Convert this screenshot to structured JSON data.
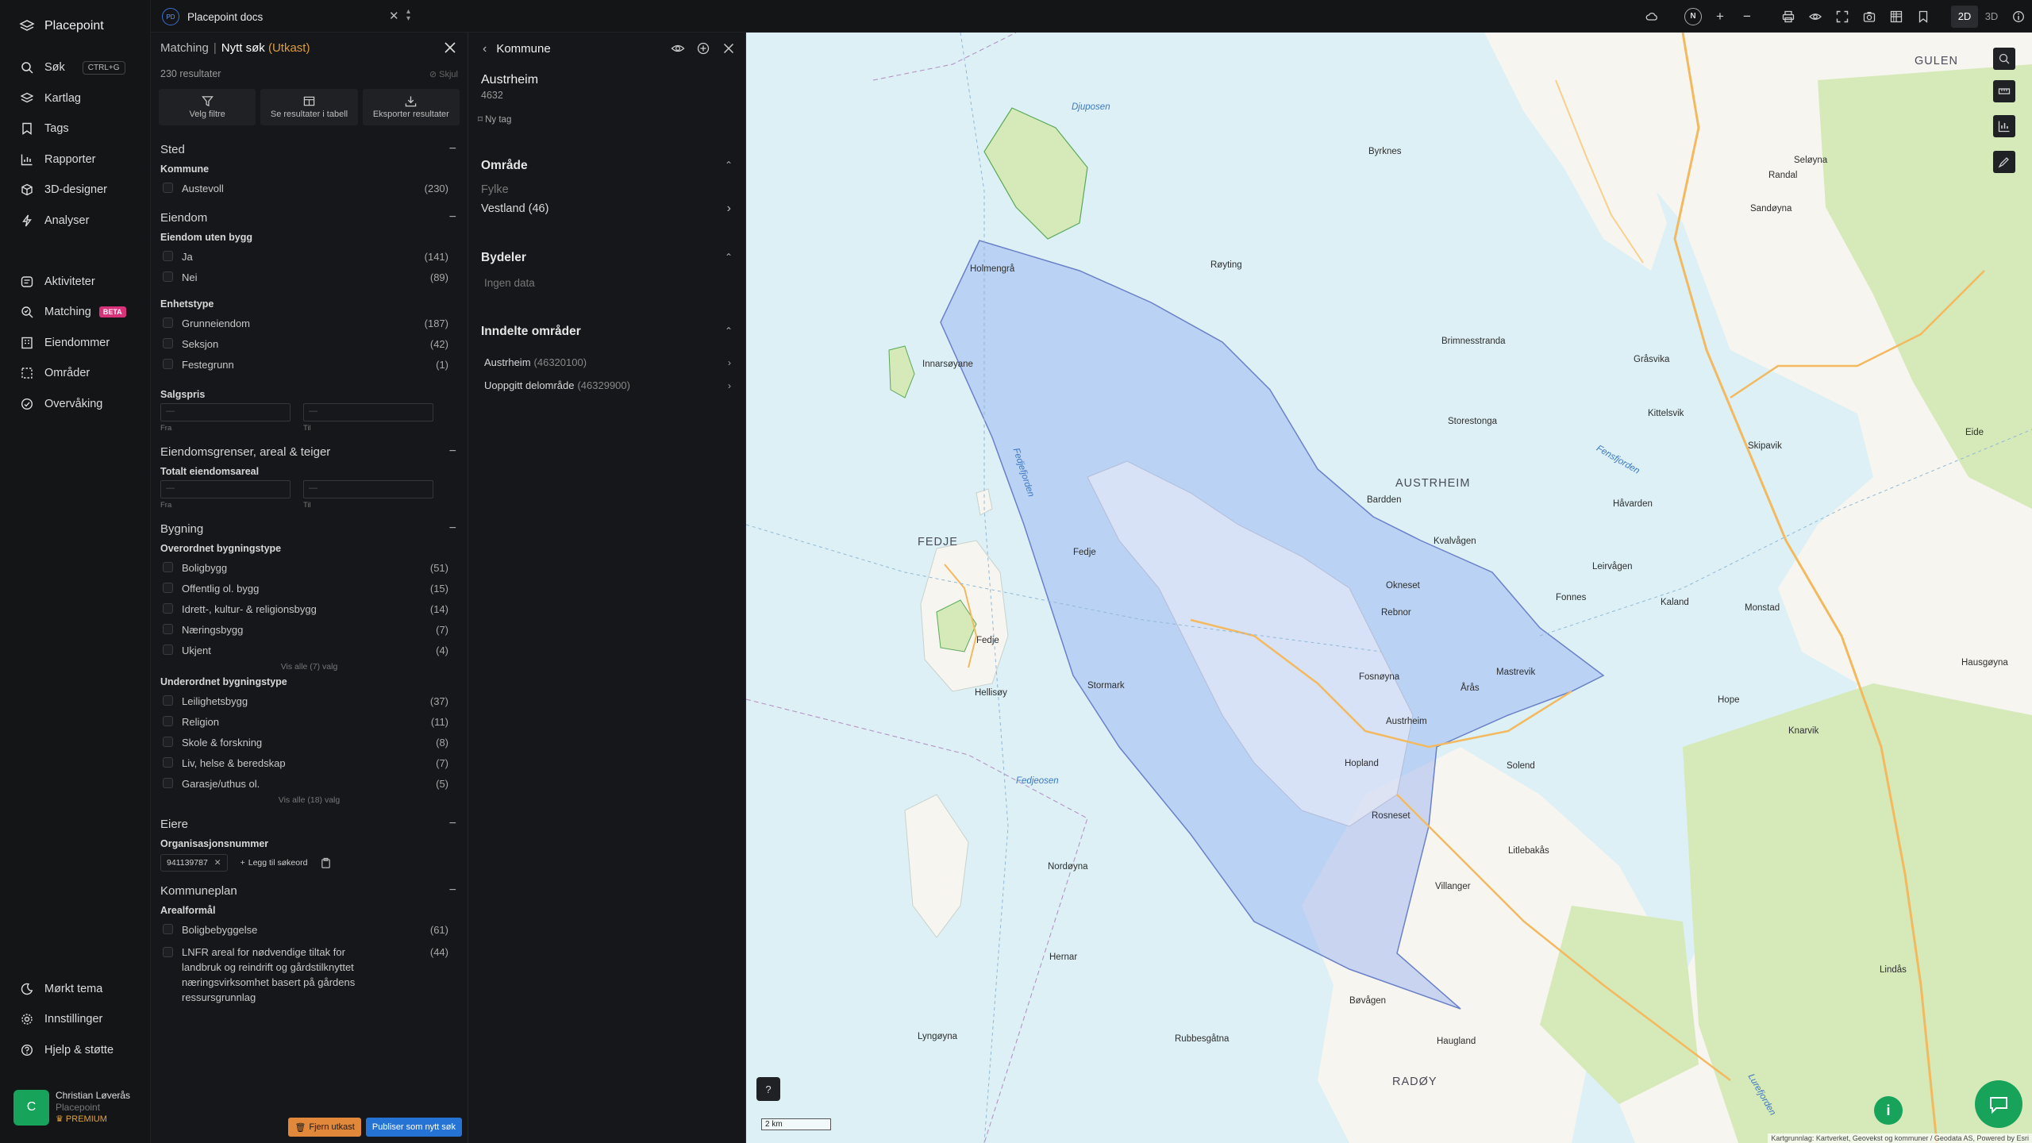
{
  "app": {
    "name": "Placepoint"
  },
  "sidebar": {
    "search": {
      "label": "Søk",
      "shortcut": "CTRL+G"
    },
    "items_top": [
      {
        "label": "Kartlag",
        "icon": "layers-icon"
      },
      {
        "label": "Tags",
        "icon": "bookmark-icon"
      },
      {
        "label": "Rapporter",
        "icon": "chart-icon"
      },
      {
        "label": "3D-designer",
        "icon": "cube-icon"
      },
      {
        "label": "Analyser",
        "icon": "bolt-icon"
      }
    ],
    "items_mid": [
      {
        "label": "Aktiviteter",
        "icon": "activity-icon"
      },
      {
        "label": "Matching",
        "icon": "matching-icon",
        "badge": "BETA"
      },
      {
        "label": "Eiendommer",
        "icon": "building-icon"
      },
      {
        "label": "Områder",
        "icon": "area-icon"
      },
      {
        "label": "Overvåking",
        "icon": "monitor-icon"
      }
    ],
    "items_bottom": [
      {
        "label": "Mørkt tema",
        "icon": "moon-icon"
      },
      {
        "label": "Innstillinger",
        "icon": "gear-icon"
      },
      {
        "label": "Hjelp & støtte",
        "icon": "help-icon"
      }
    ],
    "user": {
      "initial": "C",
      "name": "Christian Løverås",
      "org": "Placepoint",
      "plan": "PREMIUM"
    }
  },
  "topbar": {
    "workspace_badge": "PD",
    "workspace_name": "Placepoint docs",
    "compass": "N",
    "mode_2d": "2D",
    "mode_3d": "3D"
  },
  "search_panel": {
    "crumb_parent": "Matching",
    "crumb_current": "Nytt søk",
    "crumb_status": "(Utkast)",
    "result_count": "230 resultater",
    "hide_label": "Skjul",
    "actions": [
      "Velg filtre",
      "Se resultater i tabell",
      "Eksporter resultater"
    ],
    "sted": {
      "title": "Sted",
      "kommune_label": "Kommune",
      "kommune_options": [
        {
          "label": "Austevoll",
          "count": "(230)"
        }
      ]
    },
    "eiendom": {
      "title": "Eiendom",
      "uten_bygg_label": "Eiendom uten bygg",
      "uten_bygg": [
        {
          "label": "Ja",
          "count": "(141)"
        },
        {
          "label": "Nei",
          "count": "(89)"
        }
      ],
      "enhetstype_label": "Enhetstype",
      "enhetstype": [
        {
          "label": "Grunneiendom",
          "count": "(187)"
        },
        {
          "label": "Seksjon",
          "count": "(42)"
        },
        {
          "label": "Festegrunn",
          "count": "(1)"
        }
      ],
      "salgspris_label": "Salgspris",
      "from_label": "Fra",
      "to_label": "Til",
      "placeholder": "—"
    },
    "grenser": {
      "title": "Eiendomsgrenser, areal & teiger",
      "areal_label": "Totalt eiendomsareal",
      "from_label": "Fra",
      "to_label": "Til",
      "placeholder": "—"
    },
    "bygning": {
      "title": "Bygning",
      "over_label": "Overordnet bygningstype",
      "over": [
        {
          "label": "Boligbygg",
          "count": "(51)"
        },
        {
          "label": "Offentlig ol. bygg",
          "count": "(15)"
        },
        {
          "label": "Idrett-, kultur- & religionsbygg",
          "count": "(14)"
        },
        {
          "label": "Næringsbygg",
          "count": "(7)"
        },
        {
          "label": "Ukjent",
          "count": "(4)"
        }
      ],
      "over_show_all": "Vis alle (7) valg",
      "under_label": "Underordnet bygningstype",
      "under": [
        {
          "label": "Leilighetsbygg",
          "count": "(37)"
        },
        {
          "label": "Religion",
          "count": "(11)"
        },
        {
          "label": "Skole & forskning",
          "count": "(8)"
        },
        {
          "label": "Liv, helse & beredskap",
          "count": "(7)"
        },
        {
          "label": "Garasje/uthus ol.",
          "count": "(5)"
        }
      ],
      "under_show_all": "Vis alle (18) valg"
    },
    "eiere": {
      "title": "Eiere",
      "org_label": "Organisasjonsnummer",
      "chip": "941139787",
      "add_label": "Legg til søkeord"
    },
    "kommuneplan": {
      "title": "Kommuneplan",
      "areal_label": "Arealformål",
      "options": [
        {
          "label": "Boligbebyggelse",
          "count": "(61)"
        }
      ],
      "lnfr_label": "LNFR areal for nødvendige tiltak for landbruk og reindrift og gårdstilknyttet næringsvirksomhet basert på gårdens ressursgrunnlag",
      "lnfr_count": "(44)"
    },
    "footer": {
      "remove": "Fjern utkast",
      "publish": "Publiser som nytt søk"
    }
  },
  "kommune_panel": {
    "title": "Kommune",
    "name": "Austrheim",
    "number": "4632",
    "new_tag": "Ny tag",
    "omrade_title": "Område",
    "fylke_label": "Fylke",
    "fylke_value": "Vestland (46)",
    "bydeler_title": "Bydeler",
    "bydeler_empty": "Ingen data",
    "inndelte_title": "Inndelte områder",
    "inndelte": [
      {
        "name": "Austrheim",
        "code": "(46320100)"
      },
      {
        "name": "Uoppgitt delområde",
        "code": "(46329900)"
      }
    ]
  },
  "map": {
    "labels": {
      "gulen": "GULEN",
      "austrheim": "AUSTRHEIM",
      "fedje": "FEDJE",
      "radoy": "RADØY",
      "holmengra": "Holmengrå",
      "innarsoyane": "Innarsøyane",
      "fedje_town": "Fedje",
      "fedje_west": "Fedje",
      "hellisoy": "Hellisøy",
      "stormark": "Stormark",
      "fedjeosen": "Fedjeosen",
      "fedjefjorden": "Fedjefjorden",
      "fensfjorden": "Fensfjorden",
      "lurefjorden": "Lurefjorden",
      "djuposen": "Djuposen",
      "byrknes": "Byrknes",
      "rayting": "Røyting",
      "brimnesstranda": "Brimnesstranda",
      "storestonga": "Storestonga",
      "bardden": "Bardden",
      "kvalvagen": "Kvalvågen",
      "okneset": "Okneset",
      "rebnor": "Rebnor",
      "fosnoyna": "Fosnøyna",
      "austrheim_town": "Austrheim",
      "hopland": "Hopland",
      "aras": "Årås",
      "mastrevik": "Mastrevik",
      "solend": "Solend",
      "littlebakas": "Litlebakås",
      "kaland": "Kaland",
      "fonnes": "Fonnes",
      "leirvagen": "Leirvågen",
      "havarden": "Håvarden",
      "lindas": "Lindås",
      "rosnes": "Rosneset",
      "villanger": "Villanger",
      "haugland": "Haugland",
      "bovagen": "Bøvågen",
      "nordoyna": "Nordøyna",
      "hernar": "Hernar",
      "rubbesgata": "Rubbesgåtna",
      "lyngoyna": "Lyngøyna",
      "selovna": "Seløyna",
      "sandoyna": "Sandøyna",
      "randal": "Randal",
      "grasvika": "Gråsvika",
      "kittelsvik": "Kittelsvik",
      "skipavik": "Skipavik",
      "eide": "Eide",
      "monstad": "Monstad",
      "hope": "Hope",
      "hausgeyna": "Hausgøyna",
      "knarvik": "Knarvik"
    },
    "help": "?",
    "scale_label": "2 km",
    "info": "i",
    "attribution": "Kartgrunnlag: Kartverket, Geovekst og kommuner / Geodata AS, Powered by Esri"
  }
}
